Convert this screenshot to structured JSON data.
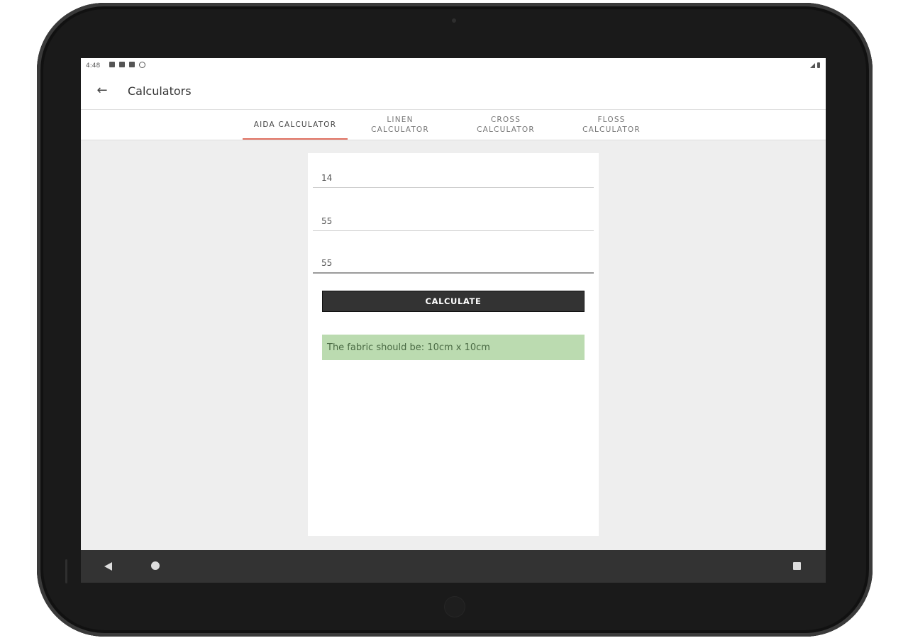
{
  "status_bar": {
    "time": "4:48",
    "icons": [
      "notification-icon",
      "share-icon",
      "sd-card-icon",
      "sync-icon"
    ],
    "right_icons": [
      "signal-icon",
      "battery-icon"
    ]
  },
  "app_bar": {
    "title": "Calculators",
    "back_icon": "arrow-left-icon"
  },
  "tabs": [
    {
      "label": "AIDA CALCULATOR",
      "active": true
    },
    {
      "label": "LINEN CALCULATOR",
      "active": false
    },
    {
      "label": "CROSS CALCULATOR",
      "active": false
    },
    {
      "label": "FLOSS CALCULATOR",
      "active": false
    }
  ],
  "form": {
    "field1_value": "14",
    "field2_value": "55",
    "field3_value": "55",
    "button_label": "CALCULATE",
    "result_text": "The fabric should be: 10cm x 10cm"
  },
  "nav_bar": {
    "icons": [
      "back-triangle-icon",
      "home-circle-icon",
      "recents-square-icon"
    ]
  },
  "colors": {
    "accent": "#e07060",
    "button_bg": "#333333",
    "result_bg": "#bbdbb0",
    "screen_bg": "#eeeeee"
  }
}
